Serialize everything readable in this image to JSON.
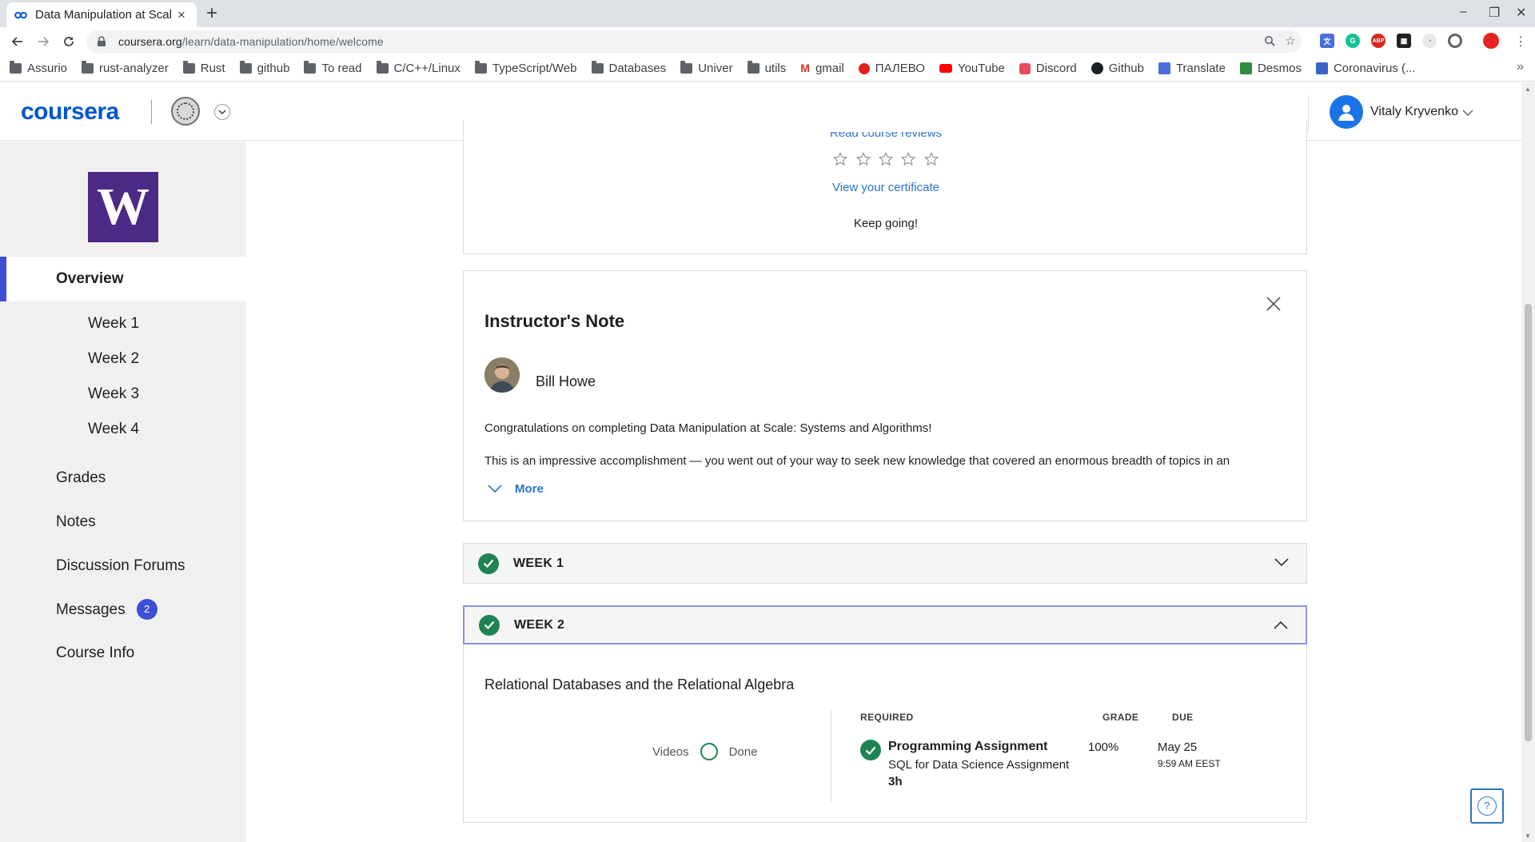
{
  "browser": {
    "tab_title": "Data Manipulation at Scal",
    "url_domain": "coursera.org",
    "url_path": "/learn/data-manipulation/home/welcome",
    "bookmarks": [
      {
        "label": "Assurio",
        "icon": "folder-icon"
      },
      {
        "label": "rust-analyzer",
        "icon": "folder-icon"
      },
      {
        "label": "Rust",
        "icon": "folder-icon"
      },
      {
        "label": "github",
        "icon": "folder-icon"
      },
      {
        "label": "To read",
        "icon": "folder-icon"
      },
      {
        "label": "C/C++/Linux",
        "icon": "folder-icon"
      },
      {
        "label": "TypeScript/Web",
        "icon": "folder-icon"
      },
      {
        "label": "Databases",
        "icon": "folder-icon"
      },
      {
        "label": "Univer",
        "icon": "folder-icon"
      },
      {
        "label": "utils",
        "icon": "folder-icon"
      },
      {
        "label": "gmail",
        "icon": "gmail-icon"
      },
      {
        "label": "ПАЛЕВО",
        "icon": "red-circle-icon"
      },
      {
        "label": "YouTube",
        "icon": "youtube-icon"
      },
      {
        "label": "Discord",
        "icon": "discord-icon"
      },
      {
        "label": "Github",
        "icon": "github-icon"
      },
      {
        "label": "Translate",
        "icon": "translate-icon"
      },
      {
        "label": "Desmos",
        "icon": "desmos-icon"
      },
      {
        "label": "Coronavirus (...",
        "icon": "gb-icon"
      }
    ],
    "extensions": [
      {
        "name": "translate-extension-icon",
        "text": "",
        "color": "#4a6ee0"
      },
      {
        "name": "grammarly-extension-icon",
        "text": "G",
        "color": "#15c39a"
      },
      {
        "name": "adblock-extension-icon",
        "text": "ABP",
        "color": "#d7281c"
      },
      {
        "name": "qr-extension-icon",
        "text": "",
        "color": "#222222"
      },
      {
        "name": "clock-extension-icon",
        "text": "",
        "color": "#e8e8e8"
      },
      {
        "name": "circle-extension-icon",
        "text": "",
        "color": "#9aa0a6"
      }
    ]
  },
  "header": {
    "logo": "coursera",
    "user_name": "Vitaly Kryvenko"
  },
  "sidebar": {
    "course_logo_letter": "W",
    "items": [
      {
        "label": "Overview",
        "active": true
      },
      {
        "label": "Week 1"
      },
      {
        "label": "Week 2"
      },
      {
        "label": "Week 3"
      },
      {
        "label": "Week 4"
      },
      {
        "label": "Grades"
      },
      {
        "label": "Notes"
      },
      {
        "label": "Discussion Forums"
      },
      {
        "label": "Messages",
        "badge": "2"
      },
      {
        "label": "Course Info"
      }
    ]
  },
  "completion_card": {
    "reviews_link": "Read course reviews",
    "rating_stars": 5,
    "certificate_link": "View your certificate",
    "message": "Keep going!"
  },
  "instructor_note": {
    "title": "Instructor's Note",
    "instructor_name": "Bill Howe",
    "paragraph1": "Congratulations on completing Data Manipulation at Scale: Systems and Algorithms!",
    "paragraph2": "This is an impressive accomplishment — you went out of your way to seek new knowledge that covered an enormous breadth of topics in an",
    "more_label": "More"
  },
  "weeks": [
    {
      "label": "WEEK 1",
      "complete": true,
      "expanded": false
    },
    {
      "label": "WEEK 2",
      "complete": true,
      "expanded": true
    }
  ],
  "week2": {
    "module_title": "Relational Databases and the Relational Algebra",
    "videos_label": "Videos",
    "videos_status": "Done",
    "columns": {
      "required": "REQUIRED",
      "grade": "GRADE",
      "due": "DUE"
    },
    "assignment": {
      "type": "Programming Assignment",
      "name": "SQL for Data Science Assignment",
      "duration": "3h",
      "grade": "100%",
      "due_date": "May 25",
      "due_time": "9:59 AM EEST"
    }
  },
  "help_label": "?"
}
